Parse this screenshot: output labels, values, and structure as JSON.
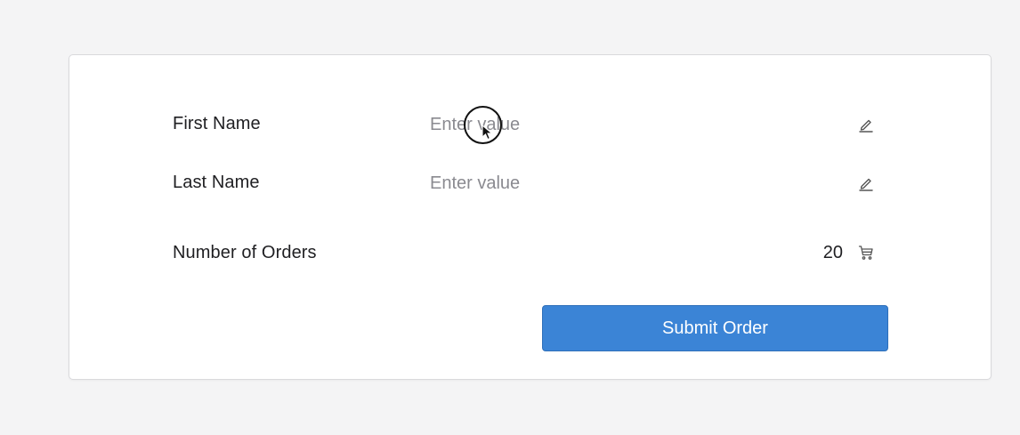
{
  "form": {
    "first_name": {
      "label": "First Name",
      "placeholder": "Enter value",
      "value": "",
      "icon": "edit-icon"
    },
    "last_name": {
      "label": "Last Name",
      "placeholder": "Enter value",
      "value": "",
      "icon": "edit-icon"
    },
    "orders": {
      "label": "Number of Orders",
      "value": "20",
      "icon": "cart-icon"
    },
    "submit_label": "Submit Order"
  },
  "colors": {
    "accent": "#3b84d6",
    "background": "#f4f4f5",
    "card": "#ffffff",
    "text": "#1f1f22",
    "placeholder": "#8a8a90"
  }
}
